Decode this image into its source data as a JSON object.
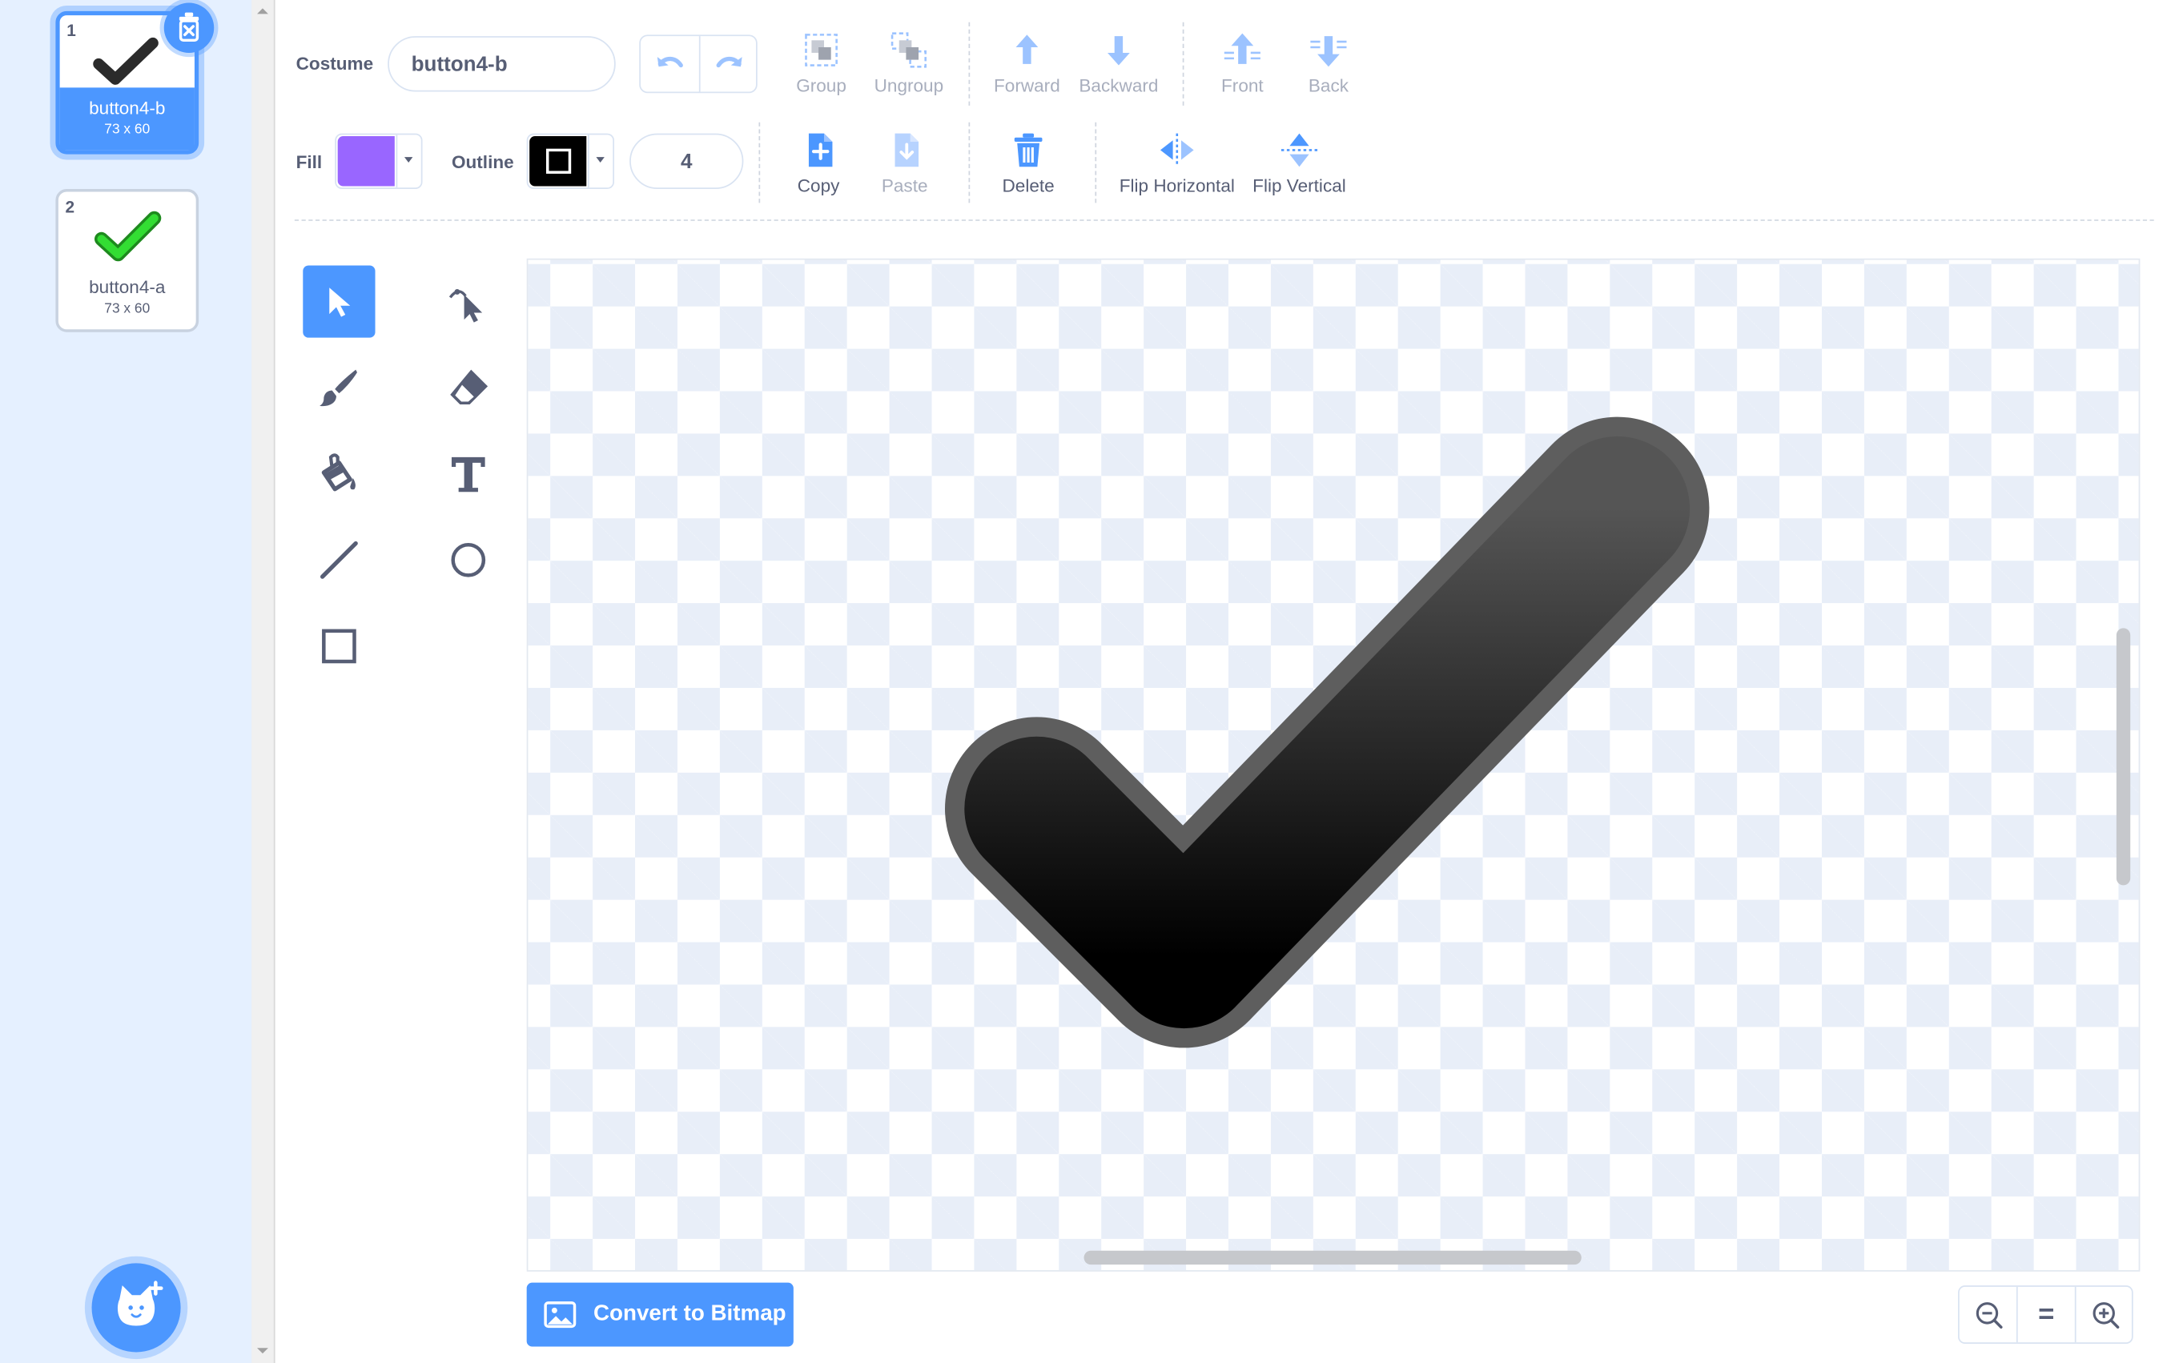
{
  "costumes": [
    {
      "number": "1",
      "name": "button4-b",
      "size": "73 x 60",
      "selected": true,
      "color": "#1a1a1a"
    },
    {
      "number": "2",
      "name": "button4-a",
      "size": "73 x 60",
      "selected": false,
      "color": "#33cc33"
    }
  ],
  "toolbar": {
    "costume_label": "Costume",
    "costume_name": "button4-b",
    "group_label": "Group",
    "ungroup_label": "Ungroup",
    "forward_label": "Forward",
    "backward_label": "Backward",
    "front_label": "Front",
    "back_label": "Back",
    "fill_label": "Fill",
    "fill_color": "#9966ff",
    "outline_label": "Outline",
    "outline_color": "#000000",
    "outline_width": "4",
    "copy_label": "Copy",
    "paste_label": "Paste",
    "delete_label": "Delete",
    "flip_horizontal_label": "Flip Horizontal",
    "flip_vertical_label": "Flip Vertical"
  },
  "tools": [
    {
      "id": "select",
      "icon": "arrow-cursor-icon",
      "active": true
    },
    {
      "id": "reshape",
      "icon": "reshape-cursor-icon",
      "active": false
    },
    {
      "id": "brush",
      "icon": "brush-icon",
      "active": false
    },
    {
      "id": "eraser",
      "icon": "eraser-icon",
      "active": false
    },
    {
      "id": "fill",
      "icon": "paint-bucket-icon",
      "active": false
    },
    {
      "id": "text",
      "icon": "text-t-icon",
      "active": false
    },
    {
      "id": "line",
      "icon": "line-icon",
      "active": false
    },
    {
      "id": "circle",
      "icon": "circle-icon",
      "active": false
    },
    {
      "id": "rectangle",
      "icon": "rectangle-icon",
      "active": false
    }
  ],
  "canvas": {
    "drawing": "checkmark",
    "drawing_colors": {
      "fill_top": "#555555",
      "fill_bottom": "#000000",
      "stroke": "#5e5e5e"
    }
  },
  "bottom": {
    "convert_label": "Convert to Bitmap",
    "zoom_reset_label": "="
  },
  "colors": {
    "accent": "#4c97ff",
    "panel_bg": "#e5f0ff",
    "text": "#575e75",
    "disabled_text": "#a8aebd"
  }
}
